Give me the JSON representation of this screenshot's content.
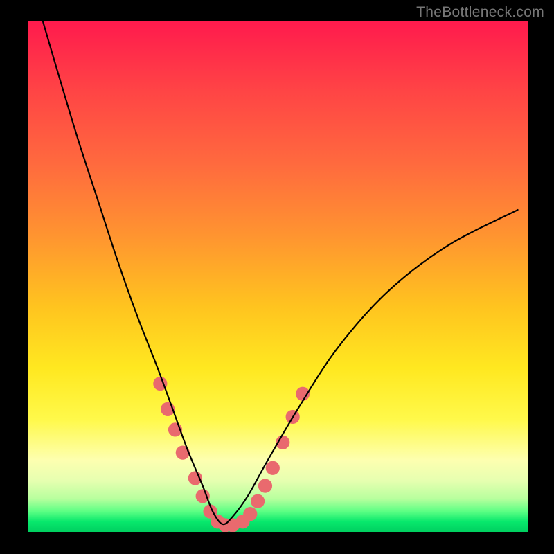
{
  "watermark": "TheBottleneck.com",
  "colors": {
    "marker": "#e96a6e",
    "curve": "#000000",
    "border": "#000000"
  },
  "chart_data": {
    "type": "line",
    "title": "",
    "xlabel": "",
    "ylabel": "",
    "xlim": [
      0,
      100
    ],
    "ylim": [
      0,
      100
    ],
    "note": "Axes are unlabeled; values are estimated from pixel positions on an implied 0–100 grid. Curve is a V-shaped bottleneck profile with minimum near x≈39.",
    "series": [
      {
        "name": "bottleneck-curve",
        "x": [
          3,
          6,
          10,
          14,
          18,
          22,
          26,
          29,
          32,
          35,
          37,
          39,
          41,
          44,
          48,
          54,
          62,
          72,
          84,
          98
        ],
        "y": [
          100,
          90,
          77,
          65,
          53,
          42,
          32,
          24,
          16,
          9,
          4,
          1.5,
          3,
          7,
          14,
          24,
          36,
          47,
          56,
          63
        ]
      }
    ],
    "markers": {
      "name": "highlighted-points",
      "note": "Salmon circular markers clustered around the curve's minimum and lower flanks.",
      "points": [
        {
          "x": 26.5,
          "y": 29
        },
        {
          "x": 28.0,
          "y": 24
        },
        {
          "x": 29.5,
          "y": 20
        },
        {
          "x": 31.0,
          "y": 15.5
        },
        {
          "x": 33.5,
          "y": 10.5
        },
        {
          "x": 35.0,
          "y": 7
        },
        {
          "x": 36.5,
          "y": 4
        },
        {
          "x": 38.0,
          "y": 2
        },
        {
          "x": 39.5,
          "y": 1.3
        },
        {
          "x": 41.0,
          "y": 1.3
        },
        {
          "x": 43.0,
          "y": 2
        },
        {
          "x": 44.5,
          "y": 3.5
        },
        {
          "x": 46.0,
          "y": 6
        },
        {
          "x": 47.5,
          "y": 9
        },
        {
          "x": 49.0,
          "y": 12.5
        },
        {
          "x": 51.0,
          "y": 17.5
        },
        {
          "x": 53.0,
          "y": 22.5
        },
        {
          "x": 55.0,
          "y": 27
        }
      ],
      "radius_pct": 1.4
    }
  }
}
